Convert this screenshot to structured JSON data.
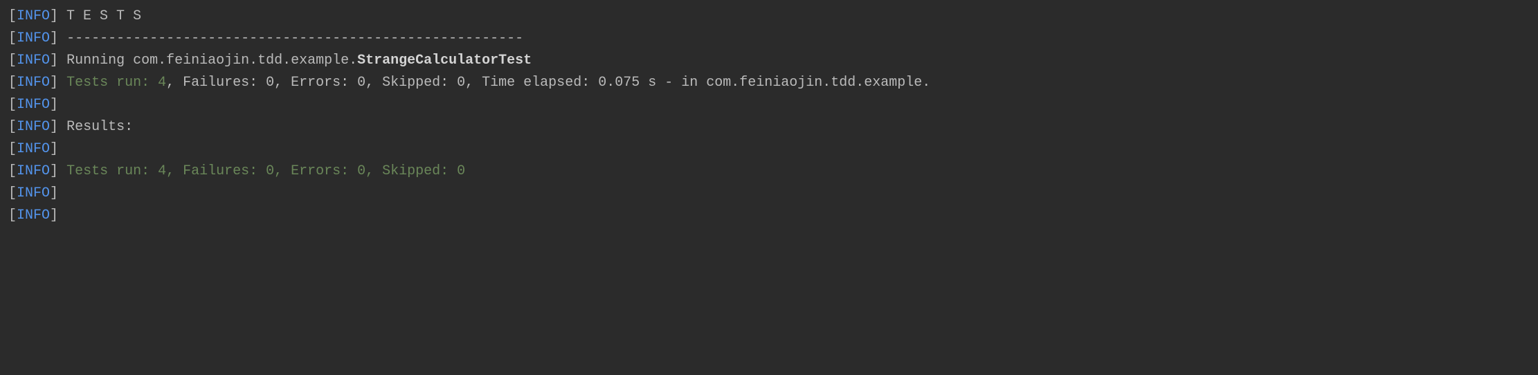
{
  "tag": "INFO",
  "bracket_open": "[",
  "bracket_close": "]",
  "lines": {
    "tests_header": " T E S T S",
    "separator": "-------------------------------------------------------",
    "running_prefix": "Running com.feiniaojin.tdd.example.",
    "running_class": "StrangeCalculatorTest",
    "tests_run_green": "Tests run: 4",
    "tests_run_rest": ", Failures: 0, Errors: 0, Skipped: 0, Time elapsed: 0.075 s - in com.feiniaojin.tdd.example.",
    "results": "Results:",
    "summary_green": "Tests run: 4, Failures: 0, Errors: 0, Skipped: 0"
  }
}
